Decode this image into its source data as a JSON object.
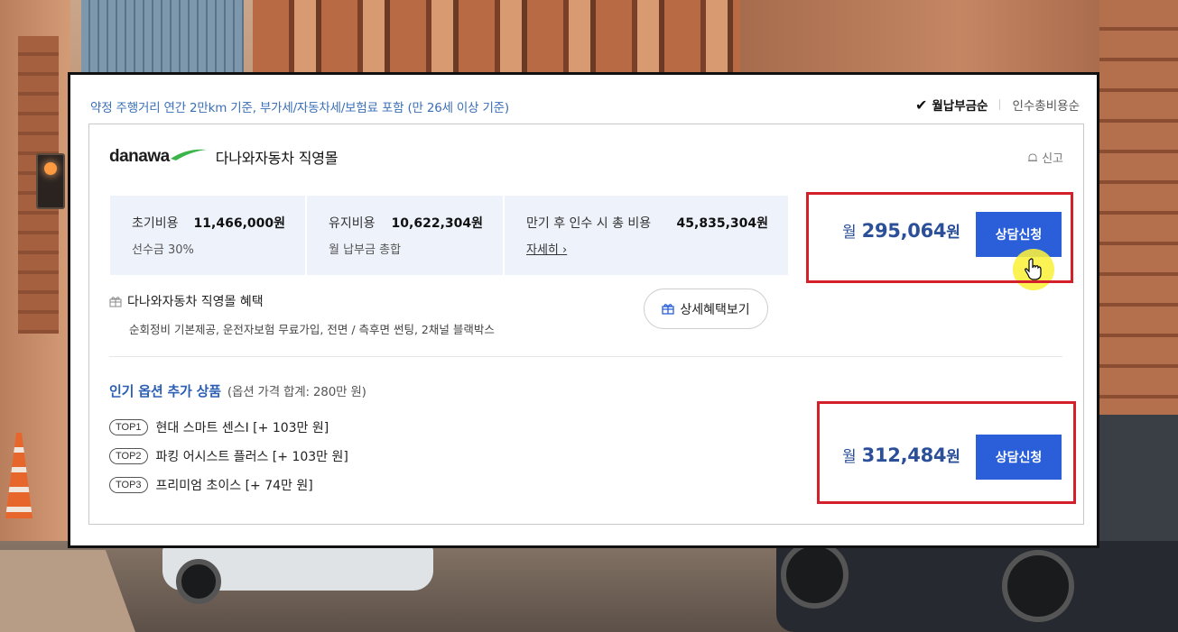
{
  "notice": "약정 주행거리 연간 2만km 기준, 부가세/자동차세/보험료 포함 (만 26세 이상 기준)",
  "sort": {
    "active": "월납부금순",
    "inactive": "인수총비용순"
  },
  "card": {
    "logo_text": "danawa",
    "seller": "다나와자동차 직영몰",
    "report": "신고",
    "costs": [
      {
        "label": "초기비용",
        "value": "11,466,000원",
        "sub": "선수금 30%"
      },
      {
        "label": "유지비용",
        "value": "10,622,304원",
        "sub": "월 납부금 총합"
      },
      {
        "label": "만기 후 인수 시 총 비용",
        "value": "45,835,304원",
        "sub": "자세히 ›"
      }
    ],
    "price": {
      "prefix": "월",
      "amount": "295,064",
      "unit": "원"
    },
    "consult_button": "상담신청",
    "benefit": {
      "title": "다나와자동차 직영몰 혜택",
      "desc": "순회정비 기본제공, 운전자보험 무료가입, 전면 / 측후면 썬팅, 2채널 블랙박스"
    },
    "detail_button": "상세혜택보기",
    "options": {
      "title": "인기 옵션 추가 상품",
      "note": "(옵션 가격 합계: 280만 원)",
      "items": [
        {
          "tag": "TOP1",
          "text": "현대 스마트 센스Ⅰ [+ 103만 원]"
        },
        {
          "tag": "TOP2",
          "text": "파킹 어시스트 플러스 [+ 103만 원]"
        },
        {
          "tag": "TOP3",
          "text": "프리미엄 초이스 [+ 74만 원]"
        }
      ],
      "price": {
        "prefix": "월",
        "amount": "312,484",
        "unit": "원"
      },
      "consult_button": "상담신청"
    }
  },
  "colors": {
    "accent_blue": "#2b5fd9",
    "price_blue": "#2c4f9a",
    "highlight_red": "#d3202a",
    "cost_bg": "#eef2fb"
  }
}
